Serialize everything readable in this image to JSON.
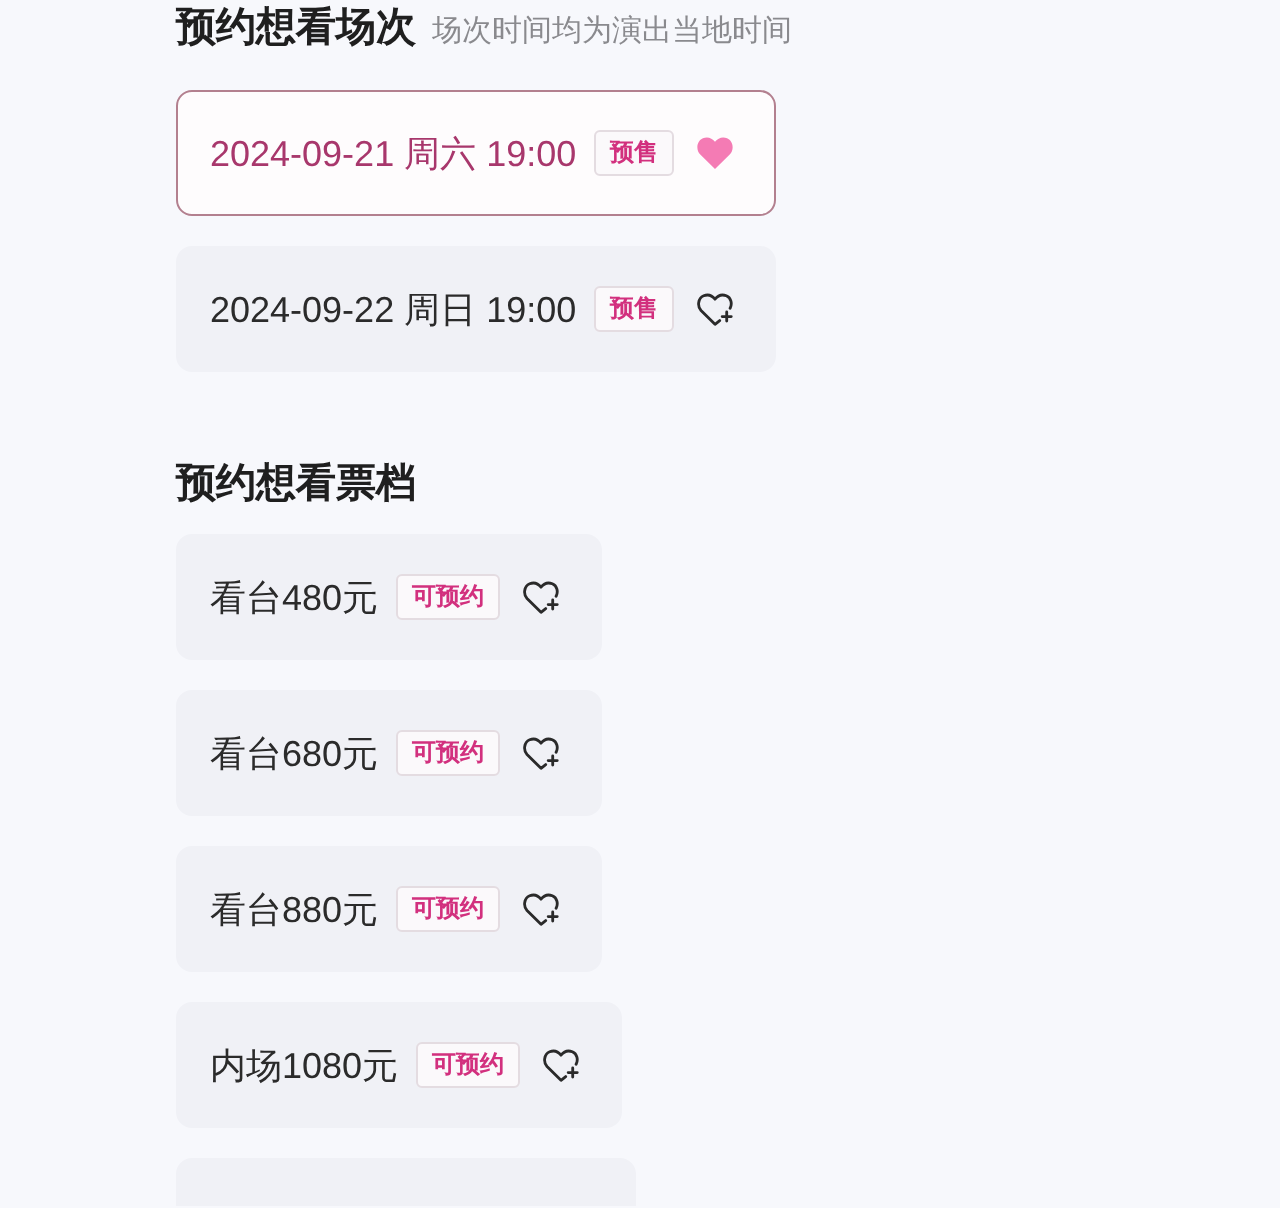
{
  "sessions_section": {
    "title": "预约想看场次",
    "note": "场次时间均为演出当地时间",
    "sessions": [
      {
        "datetime": "2024-09-21 周六 19:00",
        "tag": "预售",
        "selected": true
      },
      {
        "datetime": "2024-09-22 周日 19:00",
        "tag": "预售",
        "selected": false
      }
    ]
  },
  "tiers_section": {
    "title": "预约想看票档",
    "tiers": [
      {
        "label": "看台480元",
        "tag": "可预约",
        "selected": false
      },
      {
        "label": "看台680元",
        "tag": "可预约",
        "selected": false
      },
      {
        "label": "看台880元",
        "tag": "可预约",
        "selected": false
      },
      {
        "label": "内场1080元",
        "tag": "可预约",
        "selected": false
      },
      {
        "selected": false
      }
    ]
  }
}
